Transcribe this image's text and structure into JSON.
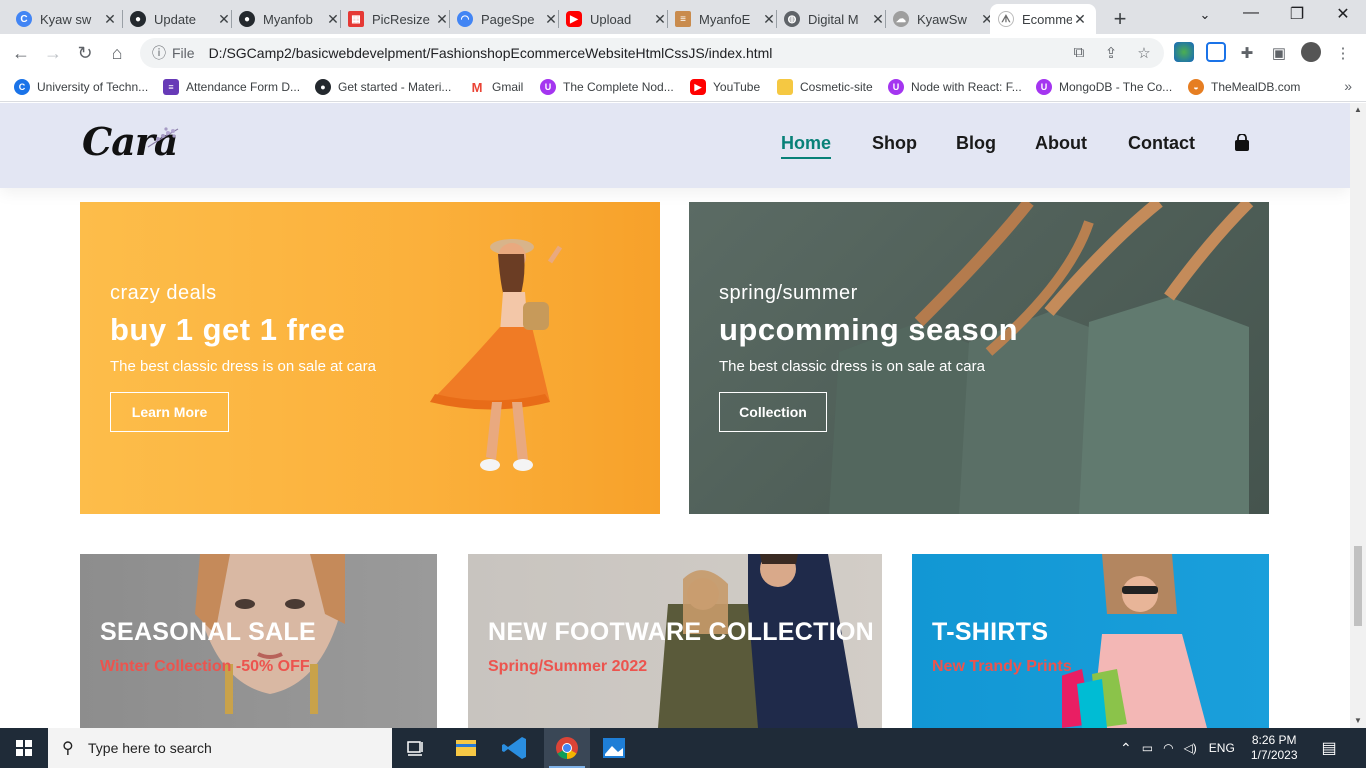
{
  "browser": {
    "tabs": [
      {
        "label": "Kyaw sw",
        "icon": "edge-like-icon",
        "color": "#4285f4"
      },
      {
        "label": "Update",
        "icon": "github-icon",
        "color": "#24292e"
      },
      {
        "label": "Myanfob",
        "icon": "github-icon",
        "color": "#24292e"
      },
      {
        "label": "PicResize",
        "icon": "grid-icon",
        "color": "#e53935"
      },
      {
        "label": "PageSpe",
        "icon": "pagespeed-icon",
        "color": "#4285f4"
      },
      {
        "label": "Upload",
        "icon": "youtube-icon",
        "color": "#ff0000"
      },
      {
        "label": "MyanfoE",
        "icon": "bookmark-icon",
        "color": "#c98b4d"
      },
      {
        "label": "Digital M",
        "icon": "globe-icon",
        "color": "#5f6368"
      },
      {
        "label": "KyawSw",
        "icon": "sheep-icon",
        "color": "#9e9e9e"
      },
      {
        "label": "Ecomme",
        "icon": "cara-icon",
        "color": "#6d6d6d"
      }
    ],
    "active_tab": 9,
    "url_scheme": "File",
    "url": "D:/SGCamp2/basicwebdevelpment/FashionshopEcommerceWebsiteHtmlCssJS/index.html",
    "bookmarks": [
      {
        "label": "University of Techn...",
        "icon": "c-icon",
        "color": "#1a73e8"
      },
      {
        "label": "Attendance Form D...",
        "icon": "form-icon",
        "color": "#673ab7"
      },
      {
        "label": "Get started - Materi...",
        "icon": "github-icon",
        "color": "#24292e"
      },
      {
        "label": "Gmail",
        "icon": "gmail-icon",
        "color": "#ea4335"
      },
      {
        "label": "The Complete Nod...",
        "icon": "udemy-icon",
        "color": "#a435f0"
      },
      {
        "label": "YouTube",
        "icon": "youtube-icon",
        "color": "#ff0000"
      },
      {
        "label": "Cosmetic-site",
        "icon": "folder-icon",
        "color": "#f5c842"
      },
      {
        "label": "Node with React: F...",
        "icon": "udemy-icon",
        "color": "#a435f0"
      },
      {
        "label": "MongoDB - The Co...",
        "icon": "udemy-icon",
        "color": "#a435f0"
      },
      {
        "label": "TheMealDB.com",
        "icon": "meal-icon",
        "color": "#e67e22"
      }
    ]
  },
  "site": {
    "logo": "Cara",
    "nav": [
      "Home",
      "Shop",
      "Blog",
      "About",
      "Contact"
    ],
    "active_nav": "Home",
    "accent": "#088178",
    "banners": [
      {
        "sub": "crazy deals",
        "title": "buy 1 get 1 free",
        "desc": "The best classic dress is on sale at cara",
        "button": "Learn More"
      },
      {
        "sub": "spring/summer",
        "title": "upcomming season",
        "desc": "The best classic dress is on sale at cara",
        "button": "Collection"
      }
    ],
    "promos": [
      {
        "title": "SEASONAL SALE",
        "subtitle": "Winter Collection -50% OFF"
      },
      {
        "title": "NEW FOOTWARE COLLECTION",
        "subtitle": "Spring/Summer 2022"
      },
      {
        "title": "T-SHIRTS",
        "subtitle": "New Trandy Prints"
      }
    ],
    "promo_subtitle_color": "#ec544e"
  },
  "taskbar": {
    "search_placeholder": "Type here to search",
    "language": "ENG",
    "time": "8:26 PM",
    "date": "1/7/2023"
  }
}
